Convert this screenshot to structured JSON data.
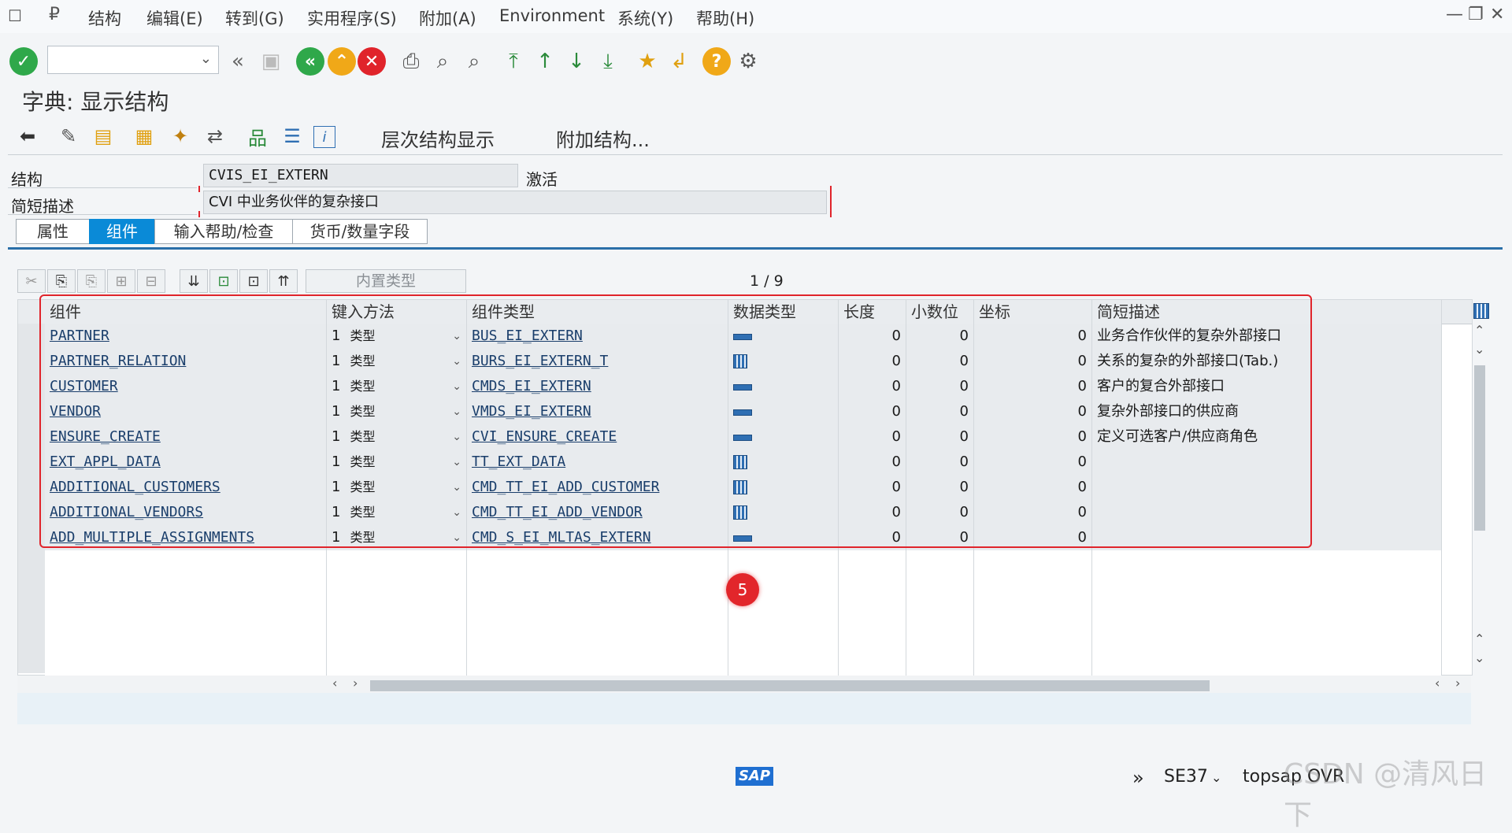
{
  "menu": {
    "items": [
      "结构",
      "编辑(E)",
      "转到(G)",
      "实用程序(S)",
      "附加(A)",
      "Environment",
      "系统(Y)",
      "帮助(H)"
    ]
  },
  "title": "字典: 显示结构",
  "app_toolbar": {
    "hierarchy_label": "层次结构显示",
    "append_label": "附加结构..."
  },
  "form": {
    "structure_label": "结构",
    "structure_value": "CVIS_EI_EXTERN",
    "status": "激活",
    "desc_label": "简短描述",
    "desc_value": "CVI 中业务伙伴的复杂接口"
  },
  "tabs": [
    {
      "label": "属性",
      "active": false
    },
    {
      "label": "组件",
      "active": true
    },
    {
      "label": "输入帮助/检查",
      "active": false
    },
    {
      "label": "货币/数量字段",
      "active": false
    }
  ],
  "table": {
    "inner_type_label": "内置类型",
    "pager": "1 / 9",
    "headers": [
      "组件",
      "键入方法",
      "组件类型",
      "数据类型",
      "长度",
      "小数位",
      "坐标",
      "简短描述"
    ],
    "rows": [
      {
        "component": "PARTNER",
        "method": "1",
        "method_type": "类型",
        "ctype": "BUS_EI_EXTERN",
        "dtype": "structure",
        "length": "0",
        "decimals": "0",
        "coord": "0",
        "desc": "业务合作伙伴的复杂外部接口"
      },
      {
        "component": "PARTNER_RELATION",
        "method": "1",
        "method_type": "类型",
        "ctype": "BURS_EI_EXTERN_T",
        "dtype": "table",
        "length": "0",
        "decimals": "0",
        "coord": "0",
        "desc": "关系的复杂的外部接口(Tab.)"
      },
      {
        "component": "CUSTOMER",
        "method": "1",
        "method_type": "类型",
        "ctype": "CMDS_EI_EXTERN",
        "dtype": "structure",
        "length": "0",
        "decimals": "0",
        "coord": "0",
        "desc": "客户的复合外部接口"
      },
      {
        "component": "VENDOR",
        "method": "1",
        "method_type": "类型",
        "ctype": "VMDS_EI_EXTERN",
        "dtype": "structure",
        "length": "0",
        "decimals": "0",
        "coord": "0",
        "desc": "复杂外部接口的供应商"
      },
      {
        "component": "ENSURE_CREATE",
        "method": "1",
        "method_type": "类型",
        "ctype": "CVI_ENSURE_CREATE",
        "dtype": "structure",
        "length": "0",
        "decimals": "0",
        "coord": "0",
        "desc": "定义可选客户/供应商角色"
      },
      {
        "component": "EXT_APPL_DATA",
        "method": "1",
        "method_type": "类型",
        "ctype": "TT_EXT_DATA",
        "dtype": "table",
        "length": "0",
        "decimals": "0",
        "coord": "0",
        "desc": ""
      },
      {
        "component": "ADDITIONAL_CUSTOMERS",
        "method": "1",
        "method_type": "类型",
        "ctype": "CMD_TT_EI_ADD_CUSTOMER",
        "dtype": "table",
        "length": "0",
        "decimals": "0",
        "coord": "0",
        "desc": ""
      },
      {
        "component": "ADDITIONAL_VENDORS",
        "method": "1",
        "method_type": "类型",
        "ctype": "CMD_TT_EI_ADD_VENDOR",
        "dtype": "table",
        "length": "0",
        "decimals": "0",
        "coord": "0",
        "desc": ""
      },
      {
        "component": "ADD_MULTIPLE_ASSIGNMENTS",
        "method": "1",
        "method_type": "类型",
        "ctype": "CMD_S_EI_MLTAS_EXTERN",
        "dtype": "structure",
        "length": "0",
        "decimals": "0",
        "coord": "0",
        "desc": ""
      }
    ]
  },
  "annotation_marker": "5",
  "status_bar": {
    "tcode": "SE37",
    "system": "topsap",
    "mode": "OVR"
  },
  "watermark": "CSDN @清风日下"
}
